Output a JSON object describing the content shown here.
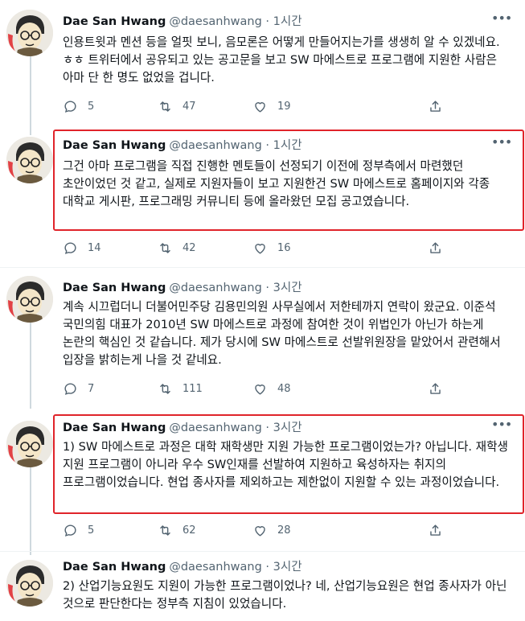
{
  "tweets": [
    {
      "name": "Dae San Hwang",
      "handle": "@daesanhwang",
      "separator": "·",
      "time": "1시간",
      "text": "인용트윗과 멘션 등을 얼핏 보니, 음모론은 어떻게 만들어지는가를 생생히 알 수 있겠네요. ㅎㅎ 트위터에서 공유되고 있는 공고문을 보고 SW 마에스트로 프로그램에 지원한 사람은 아마 단 한 명도 없었을 겁니다.",
      "replies": "5",
      "retweets": "47",
      "likes": "19",
      "highlighted": false
    },
    {
      "name": "Dae San Hwang",
      "handle": "@daesanhwang",
      "separator": "·",
      "time": "1시간",
      "text": "그건 아마 프로그램을 직접 진행한 멘토들이 선정되기 이전에 정부측에서 마련했던 초안이었던 것 같고, 실제로 지원자들이 보고 지원한건 SW 마에스트로 홈페이지와 각종 대학교 게시판, 프로그래밍 커뮤니티 등에 올라왔던 모집 공고였습니다.",
      "replies": "14",
      "retweets": "42",
      "likes": "16",
      "highlighted": true
    },
    {
      "name": "Dae San Hwang",
      "handle": "@daesanhwang",
      "separator": "·",
      "time": "3시간",
      "text": "계속 시끄럽더니 더불어민주당 김용민의원 사무실에서 저한테까지 연락이 왔군요. 이준석 국민의힘 대표가 2010년 SW 마에스트로 과정에 참여한 것이 위법인가 아닌가 하는게 논란의 핵심인 것 같습니다. 제가 당시에 SW 마에스트로 선발위원장을 맡았어서 관련해서 입장을 밝히는게 나을 것 같네요.",
      "replies": "7",
      "retweets": "111",
      "likes": "48",
      "highlighted": false
    },
    {
      "name": "Dae San Hwang",
      "handle": "@daesanhwang",
      "separator": "·",
      "time": "3시간",
      "text": "1) SW 마에스트로 과정은 대학 재학생만 지원 가능한 프로그램이었는가? 아닙니다. 재학생 지원 프로그램이 아니라 우수 SW인재를 선발하여 지원하고 육성하자는 취지의 프로그램이었습니다. 현업 종사자를 제외하고는 제한없이 지원할 수 있는 과정이었습니다.",
      "replies": "5",
      "retweets": "62",
      "likes": "28",
      "highlighted": true
    },
    {
      "name": "Dae San Hwang",
      "handle": "@daesanhwang",
      "separator": "·",
      "time": "3시간",
      "text": "2) 산업기능요원도 지원이 가능한 프로그램이었나? 네, 산업기능요원은 현업 종사자가 아닌 것으로 판단한다는 정부측 지침이 있었습니다.",
      "highlighted": false
    }
  ],
  "icons": {
    "reply": "reply-icon",
    "retweet": "retweet-icon",
    "like": "like-icon",
    "share": "share-icon",
    "more": "more-icon"
  },
  "colors": {
    "text": "#0f1419",
    "muted": "#536471",
    "highlight_border": "#e0242a",
    "thread_line": "#cfd9de"
  },
  "more_glyph": "•••"
}
